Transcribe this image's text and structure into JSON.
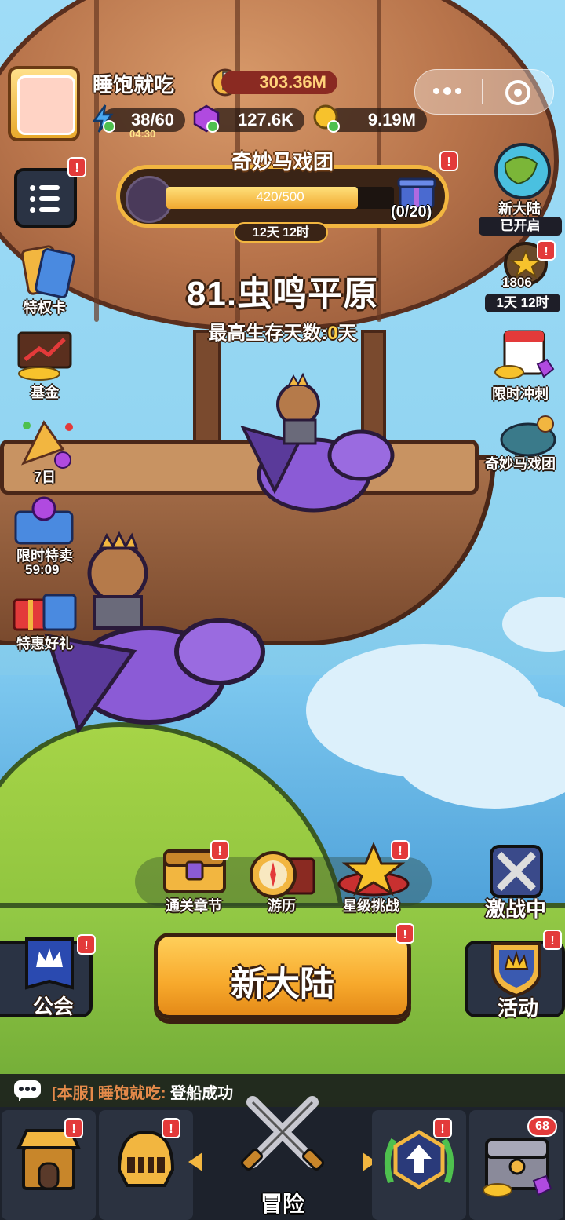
{
  "player": {
    "name": "睡饱就吃",
    "power": "303.36M"
  },
  "resources": {
    "energy": "38/60",
    "energy_timer": "04:30",
    "gems": "127.6K",
    "gold": "9.19M"
  },
  "event": {
    "title": "奇妙马戏团",
    "progress_text": "420/500",
    "progress_fraction": 0.84,
    "reward_count": "(0/20)",
    "timer": "12天 12时"
  },
  "stage": {
    "title": "81.虫鸣平原",
    "subtitle_prefix": "最高生存天数:",
    "subtitle_value": "0",
    "subtitle_suffix": "天"
  },
  "left_menu": [
    {
      "label": "特权卡"
    },
    {
      "label": "基金"
    },
    {
      "label": "7日"
    },
    {
      "label": "限时特卖",
      "timer": "59:09"
    },
    {
      "label": "特惠好礼"
    }
  ],
  "right_menu": {
    "new_continent": {
      "label": "新大陆",
      "status": "已开启"
    },
    "season": {
      "value": "1806",
      "timer": "1天 12时"
    },
    "sprint": {
      "label": "限时冲刺"
    },
    "circus": {
      "label": "奇妙马戏团"
    }
  },
  "modes": [
    {
      "label": "通关章节"
    },
    {
      "label": "游历"
    },
    {
      "label": "星级挑战"
    }
  ],
  "battle": {
    "label": "激战中"
  },
  "main_button": {
    "label": "新大陆"
  },
  "guild": {
    "label": "公会"
  },
  "activity": {
    "label": "活动"
  },
  "chat": {
    "server": "[本服]",
    "name": "睡饱就吃:",
    "message": "登船成功"
  },
  "tabbar": {
    "center_label": "冒险",
    "chest_count": "68"
  },
  "badge_mark": "!",
  "colors": {
    "primary_button": "#f7a92c",
    "badge_red": "#e33a3a",
    "accent_gold": "#f2b640"
  },
  "icons": {
    "menu": "list-icon",
    "energy": "lightning-icon",
    "gems": "gem-icon",
    "gold": "coin-icon",
    "power": "sword-icon",
    "wechat_more": "dots-icon",
    "wechat_close": "target-icon"
  }
}
